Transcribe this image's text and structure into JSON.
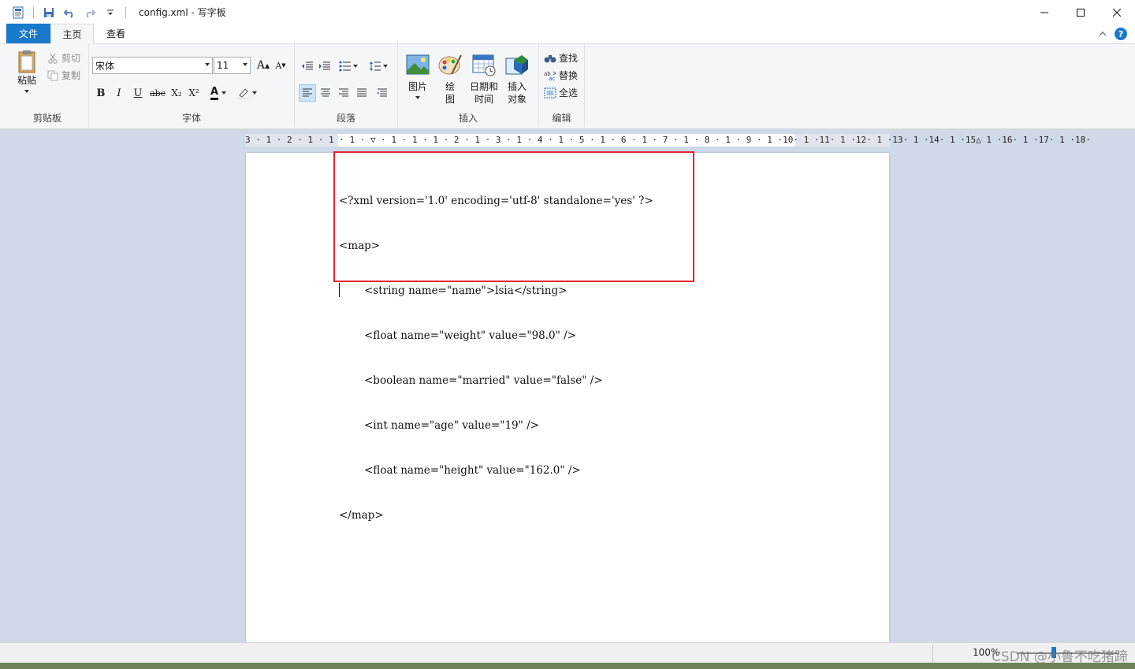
{
  "window": {
    "title": "config.xml - 写字板",
    "icons": [
      "wordpad-app-icon",
      "save-icon",
      "undo-icon",
      "redo-icon",
      "customize-qat-icon",
      "minimize-icon",
      "maximize-icon",
      "close-icon"
    ]
  },
  "tabs": {
    "file": "文件",
    "home": "主页",
    "view": "查看"
  },
  "ribbon": {
    "clipboard": {
      "label": "剪贴板",
      "paste": "粘贴",
      "cut": "剪切",
      "copy": "复制"
    },
    "font": {
      "label": "字体",
      "family": "宋体",
      "size": "11",
      "grow_glyph": "A",
      "shrink_glyph": "A",
      "bold": "B",
      "italic": "I",
      "underline": "U",
      "strike": "abc",
      "subscript": "X₂",
      "superscript": "X²",
      "font_color_glyph": "A"
    },
    "paragraph": {
      "label": "段落"
    },
    "insert": {
      "label": "插入",
      "picture": "图片",
      "paint_1": "绘",
      "paint_2": "图",
      "datetime_1": "日期和",
      "datetime_2": "时间",
      "object_1": "插入",
      "object_2": "对象"
    },
    "editing": {
      "label": "编辑",
      "find": "查找",
      "replace": "替换",
      "select_all": "全选"
    }
  },
  "ruler": {
    "text": "3 · 1 · 2 · 1 · 1 · 1 · ▽ · 1 · 1 · 1 · 2 · 1 · 3 · 1 · 4 · 1 · 5 · 1 · 6 · 1 · 7 · 1 · 8 · 1 · 9 · 1 ·10· 1 ·11· 1 ·12· 1 ·13· 1 ·14· 1 ·15△ 1 ·16· 1 ·17· 1 ·18·"
  },
  "document": {
    "lines": [
      "<?xml version='1.0' encoding='utf-8' standalone='yes' ?>",
      "<map>",
      "<string name=\"name\">lsia</string>",
      "<float name=\"weight\" value=\"98.0\" />",
      "<boolean name=\"married\" value=\"false\" />",
      "<int name=\"age\" value=\"19\" />",
      "<float name=\"height\" value=\"162.0\" />",
      "</map>"
    ]
  },
  "status": {
    "zoom": "100%",
    "watermark": "CSDN @小鲁不吃猪蹄"
  },
  "colors": {
    "accent": "#1979ca",
    "highlight_border": "#e0282e",
    "workspace": "#cfd9e8"
  }
}
